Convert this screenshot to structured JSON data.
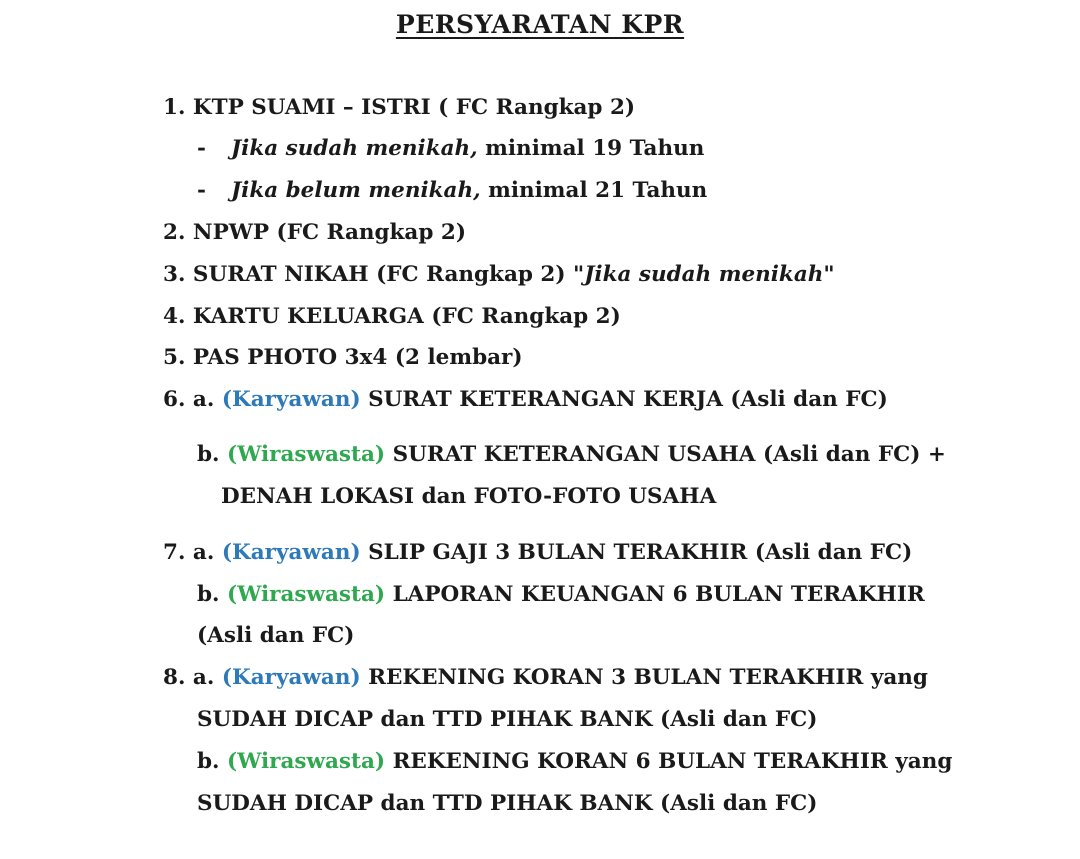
{
  "title": "PERSYARATAN KPR",
  "items": {
    "i1": {
      "text": "1. KTP SUAMI – ISTRI ( FC Rangkap 2)",
      "sub_a": {
        "bullet": "-",
        "italic": "Jika sudah menikah,",
        "rest": " minimal 19 Tahun"
      },
      "sub_b": {
        "bullet": "-",
        "italic": "Jika belum menikah,",
        "rest": " minimal 21 Tahun"
      }
    },
    "i2": {
      "text": "2. NPWP (FC Rangkap 2)"
    },
    "i3": {
      "text": "3. SURAT NIKAH (FC Rangkap 2) \"",
      "italic": "Jika sudah menikah",
      "close": "\""
    },
    "i4": {
      "text": "4. KARTU KELUARGA (FC Rangkap 2)"
    },
    "i5": {
      "text": "5. PAS PHOTO 3x4 (2 lembar)"
    },
    "i6": {
      "a_prefix": "6. a. ",
      "a_tag": "(Karyawan)",
      "a_text": " SURAT KETERANGAN KERJA (Asli dan FC)",
      "b_prefix": "b. ",
      "b_tag": "(Wiraswasta)",
      "b_text": " SURAT KETERANGAN USAHA (Asli dan FC) +",
      "b_cont": "DENAH LOKASI dan FOTO-FOTO USAHA"
    },
    "i7": {
      "a_prefix": "7. a. ",
      "a_tag": "(Karyawan)",
      "a_text": " SLIP GAJI 3 BULAN TERAKHIR (Asli dan FC)",
      "b_prefix": "b. ",
      "b_tag": "(Wiraswasta)",
      "b_text": " LAPORAN KEUANGAN 6 BULAN TERAKHIR",
      "b_cont": "(Asli dan FC)"
    },
    "i8": {
      "a_prefix": "8. a. ",
      "a_tag": "(Karyawan)",
      "a_text": " REKENING KORAN 3 BULAN TERAKHIR yang",
      "a_cont": "SUDAH DICAP dan TTD PIHAK BANK (Asli dan FC)",
      "b_prefix": "b. ",
      "b_tag": "(Wiraswasta)",
      "b_text": " REKENING KORAN 6 BULAN TERAKHIR yang",
      "b_cont": "SUDAH DICAP dan TTD PIHAK BANK (Asli dan FC)"
    }
  },
  "colors": {
    "karyawan": "#2e7ab8",
    "wiraswasta": "#2fa84f",
    "text": "#1a1a1a"
  }
}
